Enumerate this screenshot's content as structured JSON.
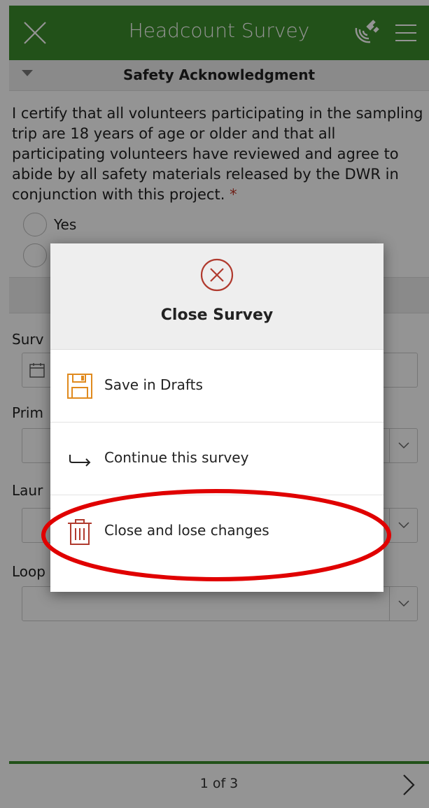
{
  "header": {
    "title": "Headcount Survey",
    "close_icon": "close-icon",
    "gps_icon": "gps-satellite-icon",
    "menu_icon": "hamburger-menu-icon"
  },
  "form": {
    "group_title": "Safety Acknowledgment",
    "question": "I certify that all volunteers participating in the sampling trip are 18 years of age or older and that all participating volunteers have reviewed and agree to abide by all safety materials released by the DWR in conjunction with this project.",
    "required_marker": "*",
    "options": [
      {
        "label": "Yes"
      }
    ],
    "fields": [
      {
        "label": "Surv"
      },
      {
        "label": "Prim"
      },
      {
        "label": "Laur"
      },
      {
        "label": "Loop ID"
      }
    ]
  },
  "dialog": {
    "title": "Close Survey",
    "icon": "close-circle-icon",
    "options": [
      {
        "label": "Save in Drafts",
        "icon": "save-icon"
      },
      {
        "label": "Continue this survey",
        "icon": "continue-arrow-icon"
      },
      {
        "label": "Close and lose changes",
        "icon": "trash-icon"
      }
    ]
  },
  "footer": {
    "page_indicator": "1 of 3",
    "next_icon": "chevron-right-icon"
  },
  "colors": {
    "header_bg": "#3c8c2c",
    "dialog_accent": "#b03a2e",
    "save_icon": "#e08a1e",
    "annotation": "#e00000"
  }
}
